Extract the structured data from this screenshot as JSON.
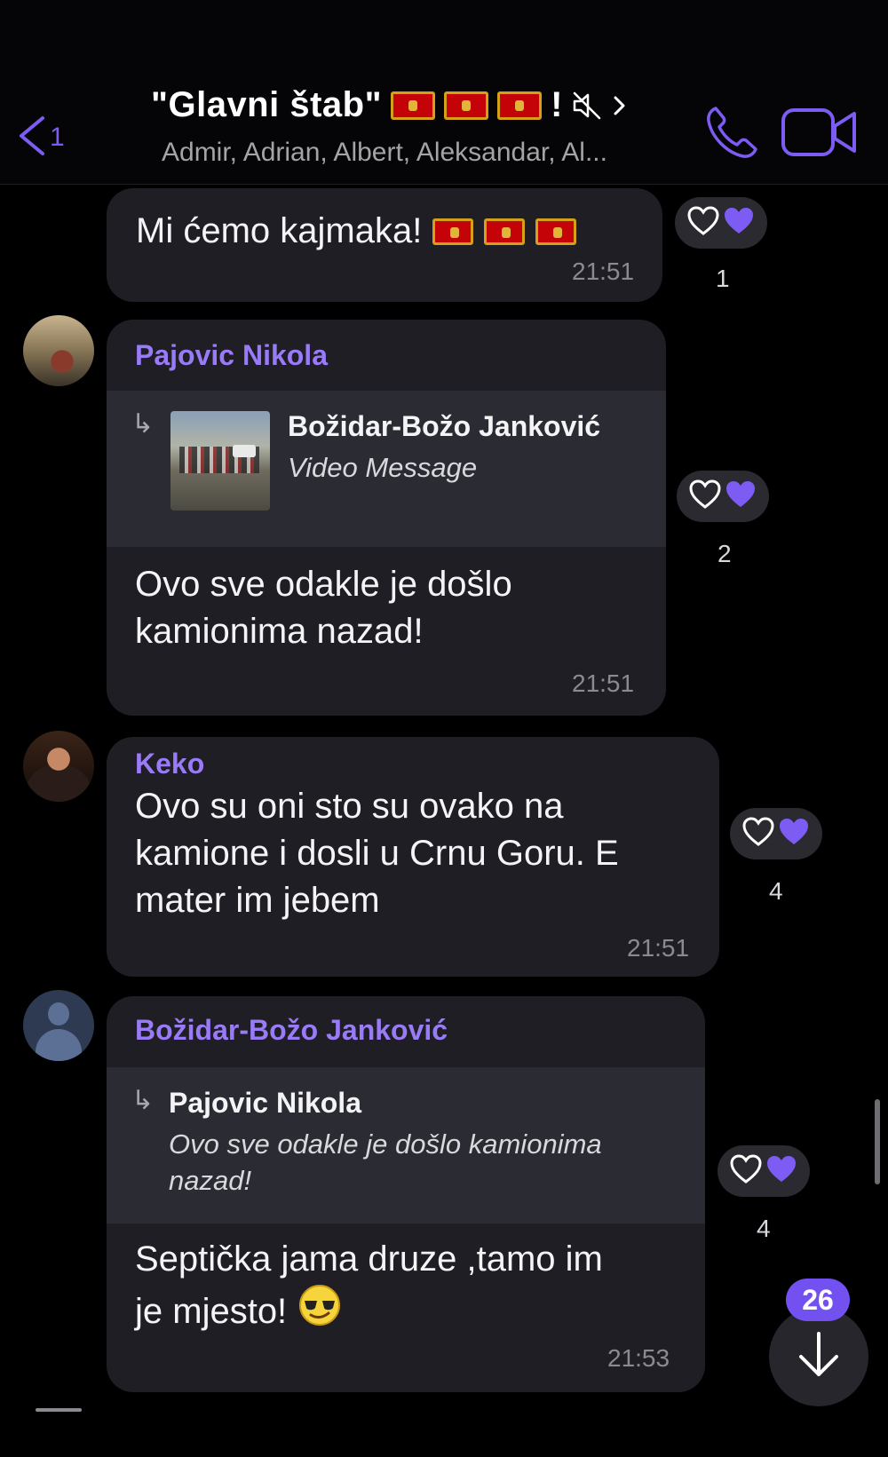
{
  "header": {
    "back_count": "1",
    "title": "\"Glavni štab\"",
    "title_suffix": "!",
    "members": "Admir, Adrian, Albert, Aleksandar, Al...",
    "icons": [
      "back-arrow-icon",
      "montenegro-flag-icon",
      "mute-icon",
      "chevron-right-icon",
      "phone-icon",
      "video-camera-icon"
    ]
  },
  "messages": [
    {
      "text": "Mi ćemo kajmaka!",
      "time": "21:51",
      "reaction_count": "1"
    },
    {
      "sender": "Pajovic Nikola",
      "quote": {
        "name": "Božidar-Božo Janković",
        "text": "Video Message"
      },
      "text_lines": [
        "Ovo sve odakle je došlo",
        "kamionima nazad!"
      ],
      "time": "21:51",
      "reaction_count": "2"
    },
    {
      "sender": "Keko",
      "text_lines": [
        "Ovo su oni sto su ovako na",
        "kamione i dosli u Crnu Goru. E",
        "mater im jebem"
      ],
      "time": "21:51",
      "reaction_count": "4"
    },
    {
      "sender": "Božidar-Božo Janković",
      "quote": {
        "name": "Pajovic Nikola",
        "text_lines": [
          "Ovo sve odakle je došlo kamionima",
          "nazad!"
        ]
      },
      "text_lines": [
        "Septička jama druze ,tamo im",
        "je mjesto!"
      ],
      "time": "21:53",
      "reaction_count": "4"
    }
  ],
  "scroll": {
    "unread_count": "26"
  },
  "colors": {
    "accent": "#7c5cf2",
    "sender": "#9a7bf7",
    "bubble": "#1e1e24",
    "quote_bg": "#2b2b33",
    "background": "#000000"
  }
}
